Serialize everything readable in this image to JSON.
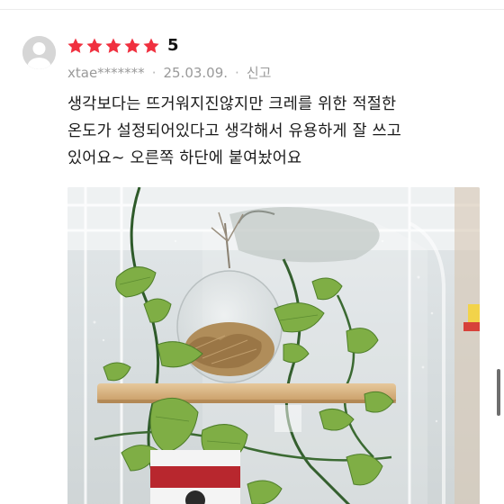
{
  "review": {
    "rating_value": "5",
    "stars_filled": 5,
    "stars_total": 5,
    "star_color": "#f0303f",
    "reviewer": "xtae*******",
    "separator": "·",
    "date": "25.03.09.",
    "report_label": "신고",
    "text_lines": [
      "생각보다는 뜨거워지진않지만 크레를 위한 적절한",
      "온도가 설정되어있다고 생각해서 유용하게 잘 쓰고",
      "있어요~ 오른쪽 하단에 붙여놨어요"
    ]
  },
  "icons": {
    "avatar": "default-user-avatar-icon",
    "star": "star-icon"
  },
  "colors": {
    "text": "#1a1a1a",
    "meta": "#9a9a9a",
    "divider": "#ececec"
  }
}
